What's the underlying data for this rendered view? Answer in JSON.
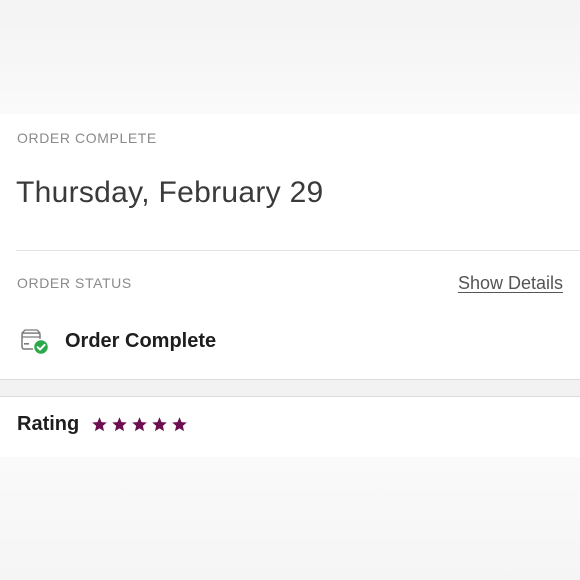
{
  "order": {
    "section_label": "ORDER COMPLETE",
    "date": "Thursday, February 29"
  },
  "status": {
    "section_label": "ORDER STATUS",
    "show_details_label": "Show Details",
    "status_text": "Order Complete",
    "icon": "package-check-icon",
    "check_color": "#2aa84a"
  },
  "rating": {
    "label": "Rating",
    "value": 5,
    "max": 5,
    "star_color": "#6b0f4f"
  }
}
